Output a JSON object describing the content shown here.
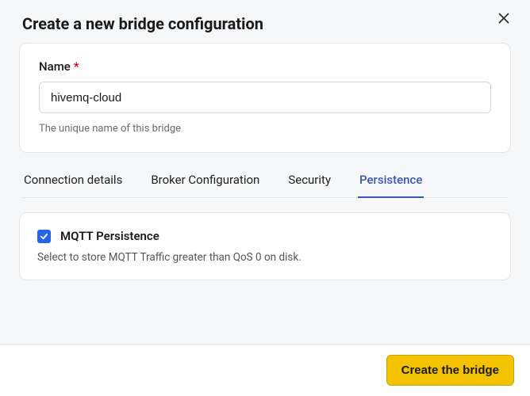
{
  "dialog": {
    "title": "Create a new bridge configuration"
  },
  "name_field": {
    "label": "Name",
    "required_mark": "*",
    "value": "hivemq-cloud",
    "help": "The unique name of this bridge"
  },
  "tabs": {
    "items": [
      {
        "label": "Connection details",
        "active": false
      },
      {
        "label": "Broker Configuration",
        "active": false
      },
      {
        "label": "Security",
        "active": false
      },
      {
        "label": "Persistence",
        "active": true
      }
    ]
  },
  "persistence": {
    "checkbox_label": "MQTT Persistence",
    "checkbox_checked": true,
    "description": "Select to store MQTT Traffic greater than QoS 0 on disk."
  },
  "footer": {
    "primary_button": "Create the bridge"
  }
}
